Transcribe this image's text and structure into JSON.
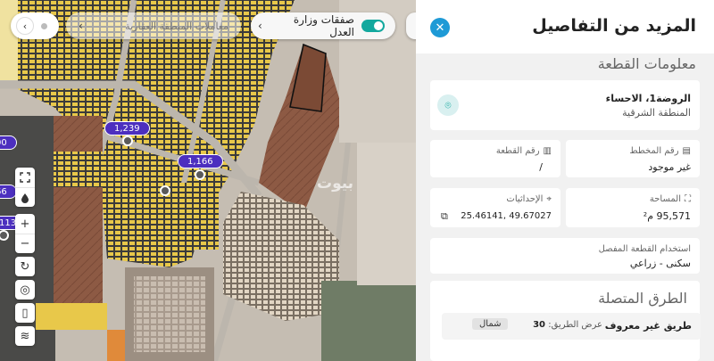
{
  "map": {
    "deals_toggle": {
      "label": "صفقات وزارة العدل",
      "on": true
    },
    "ghost_chip": {
      "label": "معاملات المنطقة العقارية"
    },
    "price_tags": [
      {
        "value": "1,239"
      },
      {
        "value": "1,166"
      },
      {
        "value": "00"
      },
      {
        "value": "66"
      },
      {
        "value": "113"
      }
    ],
    "watermark": "بيوت",
    "controls_top": [
      {
        "icon": "fullscreen-icon"
      },
      {
        "icon": "drop-icon"
      }
    ],
    "controls_zoom": [
      {
        "icon": "plus-icon",
        "glyph": "+"
      },
      {
        "icon": "minus-icon",
        "glyph": "−"
      }
    ],
    "controls_bottom": [
      {
        "icon": "rotate-icon",
        "glyph": "↻"
      },
      {
        "icon": "locate-icon",
        "glyph": "◎"
      },
      {
        "icon": "ruler-icon",
        "glyph": "▯"
      },
      {
        "icon": "layers-icon",
        "glyph": "≋"
      }
    ]
  },
  "panel": {
    "title": "المزيد من التفاصيل",
    "section_plot": "معلومات القطعة",
    "location": {
      "line1": "الروضة1، الاحساء",
      "line2": "المنطقة الشرقية"
    },
    "plan_number": {
      "label": "رقم المخطط",
      "value": "غير موجود"
    },
    "plot_number": {
      "label": "رقم القطعة",
      "value": "/"
    },
    "area": {
      "label": "المساحة",
      "value": "95,571 م²"
    },
    "coordinates": {
      "label": "الإحداثيات",
      "value": "49.67027 ,25.46141"
    },
    "land_use": {
      "label": "استخدام القطعة المفصل",
      "value": "سكنى - زراعي"
    },
    "section_roads": "الطرق المتصلة",
    "road": {
      "name": "طريق غير معروف",
      "width_label": "عرض الطريق:",
      "width_value": "30",
      "direction": "شمال"
    }
  }
}
